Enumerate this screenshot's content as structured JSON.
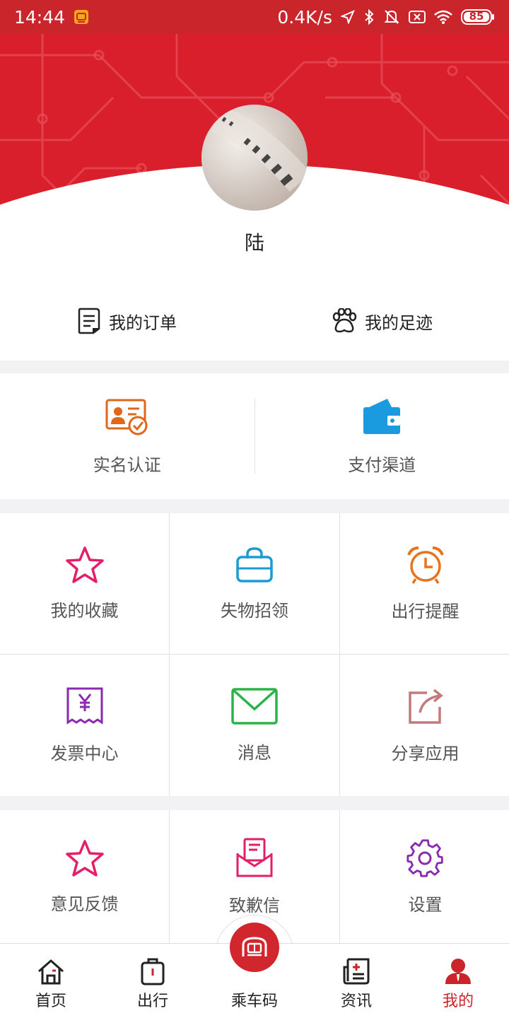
{
  "status_bar": {
    "time": "14:44",
    "network_speed": "0.4K/s",
    "battery": "85"
  },
  "profile": {
    "username": "陆"
  },
  "quick_links": [
    {
      "label": "我的订单",
      "icon": "order-list-icon"
    },
    {
      "label": "我的足迹",
      "icon": "paw-print-icon"
    }
  ],
  "cards": [
    {
      "label": "实名认证",
      "icon": "id-card-icon",
      "color": "#e0661a"
    },
    {
      "label": "支付渠道",
      "icon": "wallet-icon",
      "color": "#1a9be0"
    }
  ],
  "grid_items": [
    {
      "label": "我的收藏",
      "icon": "star-icon",
      "color": "#e51e6a"
    },
    {
      "label": "失物招领",
      "icon": "bag-icon",
      "color": "#1a9bd1"
    },
    {
      "label": "出行提醒",
      "icon": "alarm-clock-icon",
      "color": "#e8731c"
    },
    {
      "label": "发票中心",
      "icon": "invoice-icon",
      "color": "#8a2ab0"
    },
    {
      "label": "消息",
      "icon": "mail-icon",
      "color": "#2bb34a"
    },
    {
      "label": "分享应用",
      "icon": "share-icon",
      "color": "#c27a7a"
    },
    {
      "label": "意见反馈",
      "icon": "star-icon",
      "color": "#e51e6a"
    },
    {
      "label": "致歉信",
      "icon": "letter-icon",
      "color": "#e51e6a"
    },
    {
      "label": "设置",
      "icon": "gear-icon",
      "color": "#8a2ab0"
    }
  ],
  "tabbar": {
    "items": [
      {
        "label": "首页",
        "icon": "home-icon"
      },
      {
        "label": "出行",
        "icon": "luggage-icon"
      },
      {
        "label": "乘车码",
        "icon": "metro-icon"
      },
      {
        "label": "资讯",
        "icon": "news-icon"
      },
      {
        "label": "我的",
        "icon": "user-icon"
      }
    ],
    "active_color": "#c9252b"
  }
}
